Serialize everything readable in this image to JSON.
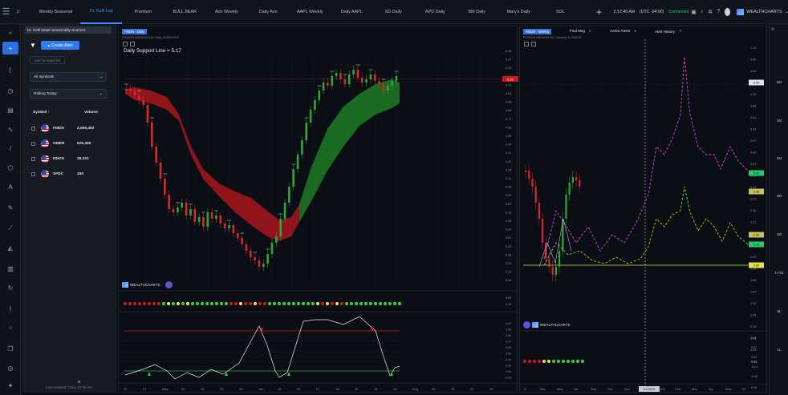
{
  "topbar": {
    "tabs": [
      "Weekly Seasonal",
      "Dr. Kelli Lap",
      "Premium",
      "BULL BEAR",
      "Aon Weekly",
      "Daily Aon",
      "AAPL Weekly",
      "Daily AAPL",
      "SD Daily",
      "APO Daily",
      "BM Daily",
      "Mary's Daily",
      "SOL"
    ],
    "active_tab": 1,
    "time": "2:12:40 AM",
    "timezone": "(UTC -04:00)",
    "connection": "Connected",
    "brand": "WEALTHCHARTS"
  },
  "scanner": {
    "title": "Dr. Kelli Wade Seasonality Scanner",
    "create_alert": "Create Alert",
    "add_to_watchlist": "Add To Watchlist",
    "symbols_select": "All Symbols",
    "period_select": "Rolling Today",
    "col_symbol": "Symbol",
    "col_volume": "Volume",
    "rows": [
      {
        "symbol": "FMDN",
        "volume": "2,599,492"
      },
      {
        "symbol": "OMER",
        "volume": "525,455"
      },
      {
        "symbol": "RDCN",
        "volume": "28,321"
      },
      {
        "symbol": "SFDC",
        "volume": "250"
      }
    ],
    "updated": "Last Updated: Today 07:58 AM"
  },
  "left_chart": {
    "tab": "FMDN - Daily",
    "subtitle": "FUSION MEDIDN INC  Daily  52/60/2022",
    "study_label": "Daily Support Line = 5.17",
    "brand": "WEALTHCHARTS",
    "price_ticks": [
      "5.46",
      "5.37",
      "5.28",
      "5.19",
      "5.10",
      "5.04",
      "4.95",
      "4.86",
      "4.77",
      "4.68",
      "4.59",
      "4.50",
      "4.41",
      "4.32",
      "4.23",
      "4.14",
      "4.05",
      "3.96",
      "3.87",
      "3.78",
      "3.69",
      "3.60",
      "3.51",
      "3.42",
      "3.33",
      "3.24",
      "3.15",
      "3.06"
    ],
    "current_price": "5.20",
    "osc_ticks": [
      "4.00",
      "3.90",
      "3.80",
      "3.70",
      "3.60",
      "3.50",
      "3.40",
      "3.30",
      "3.20",
      "3.10"
    ],
    "x_ticks": [
      "22",
      "27",
      "May",
      "09",
      "16",
      "23",
      "30",
      "Jun",
      "13",
      "20",
      "27",
      "Jul",
      "11",
      "18",
      "25",
      "Aug",
      "08",
      "15",
      "22",
      "29"
    ]
  },
  "right_chart": {
    "tab": "FMDN - Weekly",
    "tab_find": "Find Msg",
    "tab_alerts": "Active Alerts",
    "tab_history": "Alert History",
    "subtitle": "FUSION MEDIDN INC  Weekly  1/29/2022",
    "brand": "WEALTHCHARTS",
    "price_ticks": [
      "7.23",
      "6.96",
      "6.69",
      "6.42",
      "6.15",
      "5.88",
      "5.61",
      "5.34",
      "5.07",
      "4.80",
      "4.53",
      "4.26",
      "4.02",
      "3.75",
      "3.48",
      "3.21",
      "2.94",
      "2.67",
      "2.40",
      "2.13",
      "1.86",
      "1.59",
      "1.32",
      "1.05",
      "0.78",
      "0.51",
      "0.24",
      "-0.03"
    ],
    "badges": [
      {
        "label": "5.05",
        "color": "#dfe3ea"
      },
      {
        "label": "5.03",
        "color": "#28c76f"
      },
      {
        "label": "3.38",
        "color": "#c8c05a"
      },
      {
        "label": "2.02",
        "color": "#c8c05a"
      },
      {
        "label": "1.72",
        "color": "#28c76f"
      },
      {
        "label": "0.50",
        "color": "#e6e04a"
      }
    ],
    "lower_value": "0.03",
    "x_ticks": [
      "11",
      "Mar",
      "May",
      "Jul",
      "Sep",
      "Oct",
      "Nov",
      "1/1/2023",
      "2023",
      "Feb",
      "Mar",
      "Apr",
      "May",
      "22"
    ],
    "x_highlight": "1/1/2023"
  },
  "right_strip": {
    "labels": [
      "6M",
      "1M",
      "4M",
      "3M",
      "1W",
      "1YTD",
      "5L",
      "1L"
    ],
    "right_extra": "0.03"
  },
  "colors": {
    "accent": "#2f7bf0",
    "bull": "#1f8f2a",
    "bear": "#c8191e",
    "magenta": "#d846e0",
    "lime": "#7fdc1e",
    "yellow": "#e6e04a"
  }
}
